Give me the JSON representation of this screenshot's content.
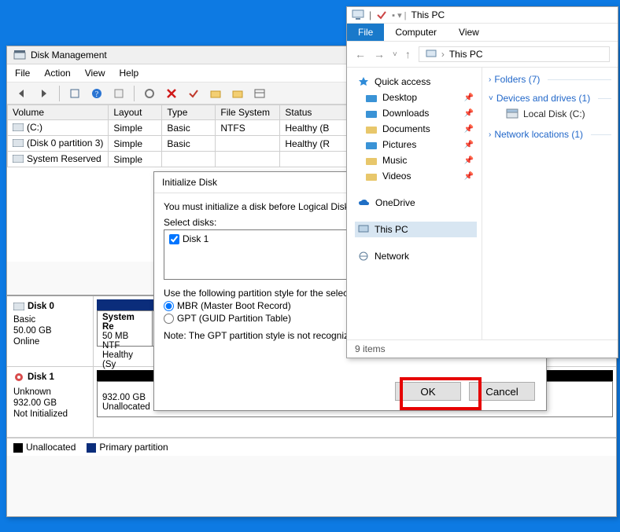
{
  "dm": {
    "title": "Disk Management",
    "menus": [
      "File",
      "Action",
      "View",
      "Help"
    ],
    "columns": [
      "Volume",
      "Layout",
      "Type",
      "File System",
      "Status"
    ],
    "volumes": [
      {
        "name": "(C:)",
        "layout": "Simple",
        "type": "Basic",
        "fs": "NTFS",
        "status": "Healthy (B"
      },
      {
        "name": "(Disk 0 partition 3)",
        "layout": "Simple",
        "type": "Basic",
        "fs": "",
        "status": "Healthy (R"
      },
      {
        "name": "System Reserved",
        "layout": "Simple",
        "type": "",
        "fs": "",
        "status": ""
      }
    ],
    "disk0": {
      "label_lines": [
        "Disk 0",
        "Basic",
        "50.00 GB",
        "Online"
      ],
      "seg0_lines": [
        "System Re",
        "50 MB NTF",
        "Healthy (Sy"
      ]
    },
    "disk1": {
      "label_lines": [
        "Disk 1",
        "Unknown",
        "932.00 GB",
        "Not Initialized"
      ],
      "seg0_lines": [
        "932.00 GB",
        "Unallocated"
      ]
    },
    "legend": {
      "unalloc": "Unallocated",
      "primary": "Primary partition"
    }
  },
  "init": {
    "title": "Initialize Disk",
    "msg": "You must initialize a disk before Logical Disk Mana",
    "select_label": "Select disks:",
    "disk_item": "Disk 1",
    "style_label": "Use the following partition style for the selected dis",
    "mbr": "MBR (Master Boot Record)",
    "gpt": "GPT (GUID Partition Table)",
    "note": "Note: The GPT partition style is not recognized by all previous versions of Windows.",
    "ok": "OK",
    "cancel": "Cancel"
  },
  "exp": {
    "tab_title": "This PC",
    "ribbon": {
      "file": "File",
      "computer": "Computer",
      "view": "View"
    },
    "breadcrumb": [
      "This PC"
    ],
    "quick_access_label": "Quick access",
    "quick_items": [
      "Desktop",
      "Downloads",
      "Documents",
      "Pictures",
      "Music",
      "Videos"
    ],
    "onedrive": "OneDrive",
    "thispc": "This PC",
    "network": "Network",
    "groups": {
      "folders": {
        "label": "Folders (7)"
      },
      "devices": {
        "label": "Devices and drives (1)",
        "item": "Local Disk (C:)"
      },
      "netloc": {
        "label": "Network locations (1)"
      }
    },
    "status": "9 items"
  }
}
